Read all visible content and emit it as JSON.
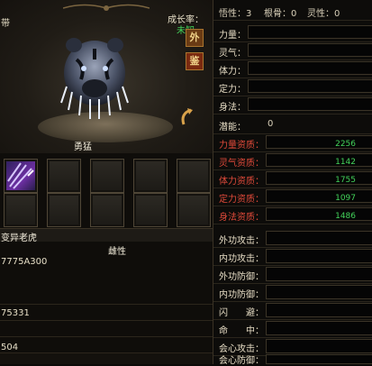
{
  "pet": {
    "type_partial": "带",
    "growth_label": "成长率：",
    "growth_value": "未知",
    "btn_wai": "外",
    "btn_jian": "鉴",
    "trait": "勇猛",
    "name": "变异老虎",
    "gender": "雌性",
    "id_partial": "7775A300",
    "num1": "75331",
    "num2": "504"
  },
  "right_top": {
    "xingxing": "悟性：3",
    "gengu": "根骨：0",
    "lingxing": "灵性：0"
  },
  "stats": [
    {
      "label": "力量："
    },
    {
      "label": "灵气："
    },
    {
      "label": "体力："
    },
    {
      "label": "定力："
    },
    {
      "label": "身法："
    }
  ],
  "potential": {
    "label": "潜能：",
    "value": "0"
  },
  "aptitudes": [
    {
      "label": "力量资质：",
      "value": "2256"
    },
    {
      "label": "灵气资质：",
      "value": "1142"
    },
    {
      "label": "体力资质：",
      "value": "1755"
    },
    {
      "label": "定力资质：",
      "value": "1097"
    },
    {
      "label": "身法资质：",
      "value": "1486"
    }
  ],
  "combat": [
    {
      "label": "外功攻击："
    },
    {
      "label": "内功攻击："
    },
    {
      "label": "外功防御："
    },
    {
      "label": "内功防御："
    },
    {
      "label": "闪　　避："
    },
    {
      "label": "命　　中："
    },
    {
      "label": "会心攻击："
    },
    {
      "label": "会心防御："
    }
  ],
  "colors": {
    "accent_green": "#43d35a",
    "aptitude_red": "#e04a3a",
    "gold": "#d9b25a"
  }
}
